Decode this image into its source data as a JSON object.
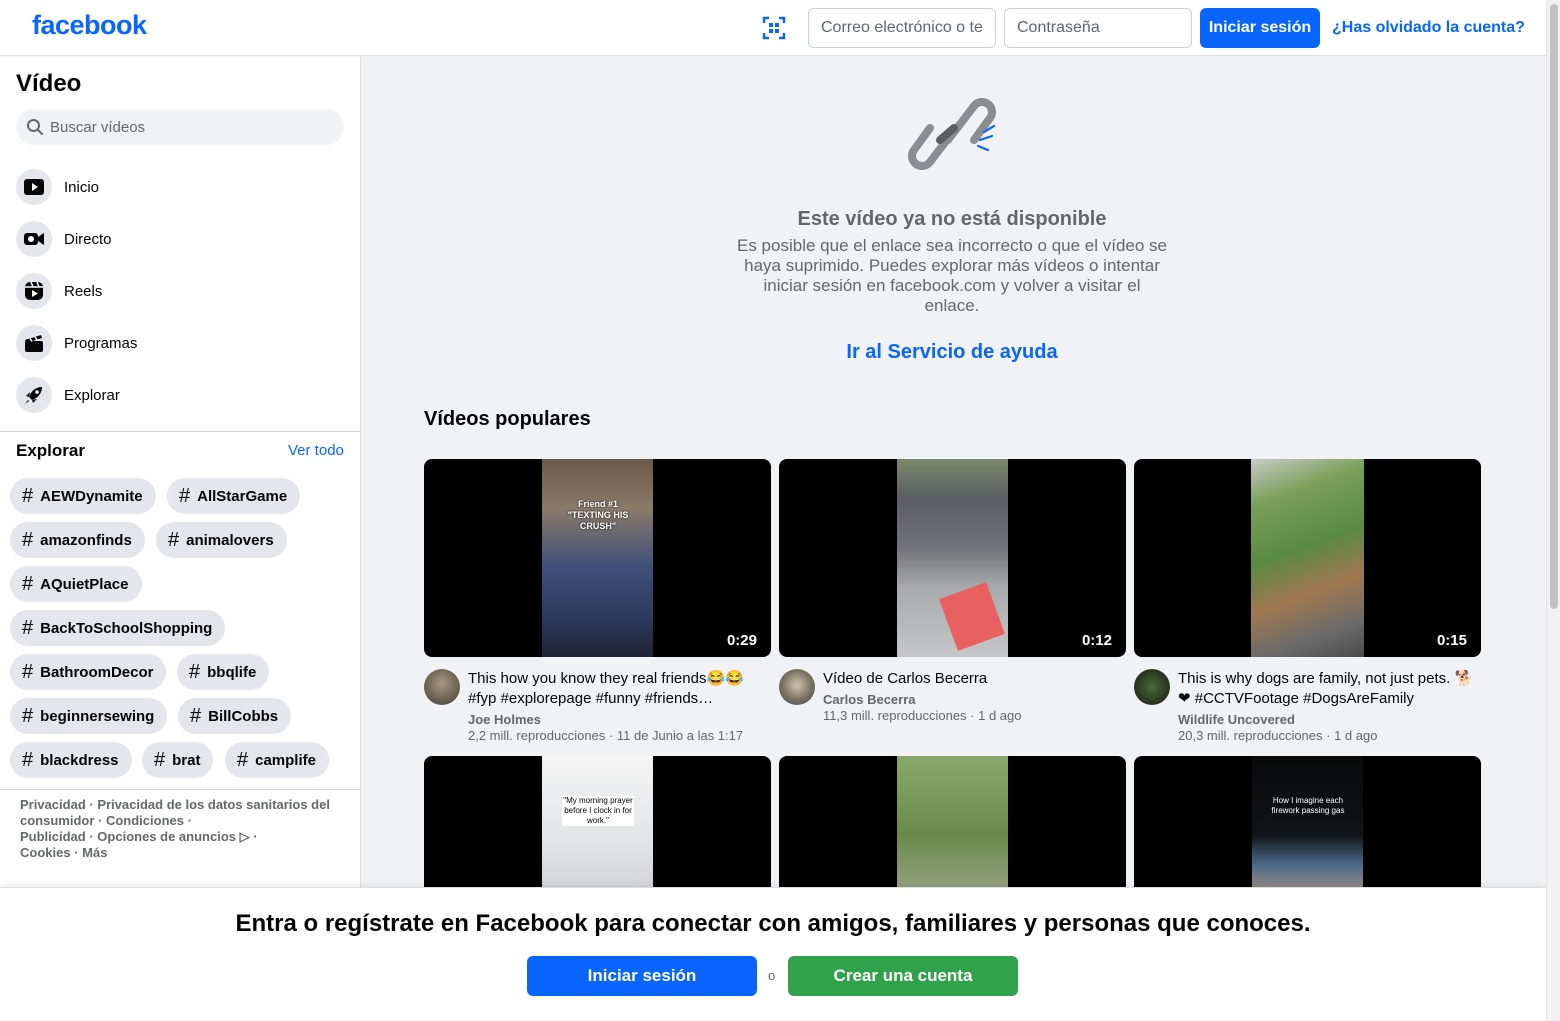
{
  "header": {
    "logo": "facebook",
    "email_placeholder": "Correo electrónico o teléfono",
    "password_placeholder": "Contraseña",
    "login_label": "Iniciar sesión",
    "forgot_label": "¿Has olvidado la cuenta?"
  },
  "sidebar": {
    "title": "Vídeo",
    "search_placeholder": "Buscar vídeos",
    "nav": [
      {
        "label": "Inicio",
        "icon": "play-icon"
      },
      {
        "label": "Directo",
        "icon": "live-icon"
      },
      {
        "label": "Reels",
        "icon": "reels-icon"
      },
      {
        "label": "Programas",
        "icon": "clapper-icon"
      },
      {
        "label": "Explorar",
        "icon": "rocket-icon"
      }
    ],
    "explore_title": "Explorar",
    "see_all": "Ver todo",
    "tags": [
      "AEWDynamite",
      "AllStarGame",
      "amazonfinds",
      "animalovers",
      "AQuietPlace",
      "BackToSchoolShopping",
      "BathroomDecor",
      "bbqlife",
      "beginnersewing",
      "BillCobbs",
      "blackdress",
      "brat",
      "camplife"
    ],
    "footer": {
      "l1": "Privacidad",
      "l2": "Privacidad de los datos sanitarios del consumidor",
      "l3": "Condiciones",
      "l4": "Publicidad",
      "l5": "Opciones de anuncios ▷",
      "l6": "Cookies",
      "l7": "Más",
      "sep": " · "
    }
  },
  "main": {
    "unavailable_title": "Este vídeo ya no está disponible",
    "unavailable_desc": "Es posible que el enlace sea incorrecto o que el vídeo se haya suprimido. Puedes explorar más vídeos o intentar iniciar sesión en facebook.com y volver a visitar el enlace.",
    "help_link": "Ir al Servicio de ayuda",
    "popular_title": "Vídeos populares",
    "thumb_text_1": "Friend #1 \"TEXTING HIS CRUSH\"",
    "thumb_text_4": "\"My morning prayer before I clock in for work.\"",
    "thumb_text_6": "How I imagine each firework passing gas",
    "videos": [
      {
        "title": "This how you know they real friends😂😂 #fyp #explorepage #funny #friends…",
        "author": "Joe Holmes",
        "views": "2,2 mill. reproducciones",
        "date": "11 de Junio a las 1:17",
        "duration": "0:29"
      },
      {
        "title": "Vídeo de Carlos Becerra",
        "author": "Carlos Becerra",
        "views": "11,3 mill. reproducciones",
        "date": "1 d ago",
        "duration": "0:12"
      },
      {
        "title": "This is why dogs are family, not just pets. 🐕❤ #CCTVFootage #DogsAreFamily",
        "author": "Wildlife Uncovered",
        "views": "20,3 mill. reproducciones",
        "date": "1 d ago",
        "duration": "0:15"
      }
    ],
    "meta_sep": " · "
  },
  "banner": {
    "text": "Entra o regístrate en Facebook para conectar con amigos, familiares y personas que conoces.",
    "login_label": "Iniciar sesión",
    "or": "o",
    "create_label": "Crear una cuenta"
  },
  "colors": {
    "brand": "#0866ff",
    "create": "#31a24c",
    "background": "#f0f2f5"
  }
}
